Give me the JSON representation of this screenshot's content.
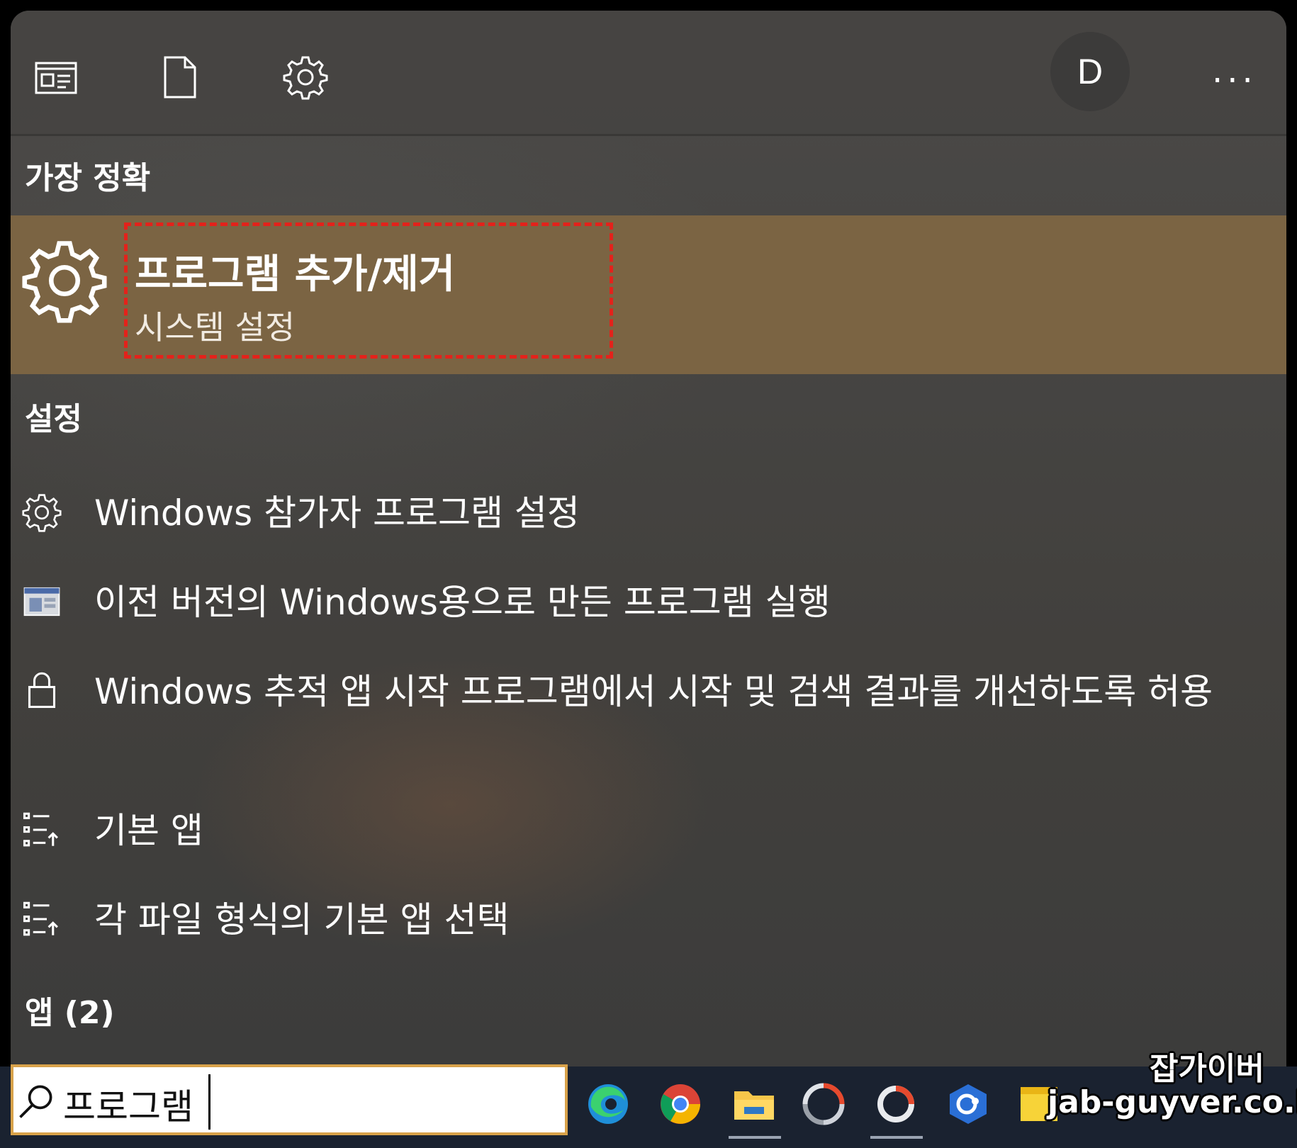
{
  "topbar": {
    "icons": [
      "news-icon",
      "document-icon",
      "settings-gear-icon"
    ],
    "avatar_letter": "D",
    "more": "..."
  },
  "best_match": {
    "heading": "가장 정확",
    "title": "프로그램 추가/제거",
    "subtitle": "시스템 설정",
    "icon": "settings-gear-icon",
    "highlight_color": "#7b6443",
    "annotation_color": "#e3221b"
  },
  "settings": {
    "heading": "설정",
    "items": [
      {
        "icon": "gear-icon",
        "label": "Windows 참가자 프로그램 설정"
      },
      {
        "icon": "legacy-window-icon",
        "label": "이전 버전의 Windows용으로 만든 프로그램 실행"
      },
      {
        "icon": "lock-icon",
        "label": "Windows 추적 앱 시작 프로그램에서 시작 및 검색 결과를 개선하도록 허용"
      },
      {
        "icon": "default-apps-icon",
        "label": "기본 앱"
      },
      {
        "icon": "default-apps-icon",
        "label": "각 파일 형식의 기본 앱 선택"
      }
    ]
  },
  "apps": {
    "heading": "앱 (2)"
  },
  "search": {
    "value": "프로그램",
    "icon": "search-icon"
  },
  "taskbar": {
    "icons": [
      "edge-icon",
      "chrome-icon",
      "file-explorer-icon",
      "capture-app-icon",
      "circle-app-icon",
      "remote-app-icon",
      "sticky-app-icon"
    ]
  },
  "watermark": {
    "name": "잡가이버",
    "url": "jab-guyver.co.kr"
  }
}
